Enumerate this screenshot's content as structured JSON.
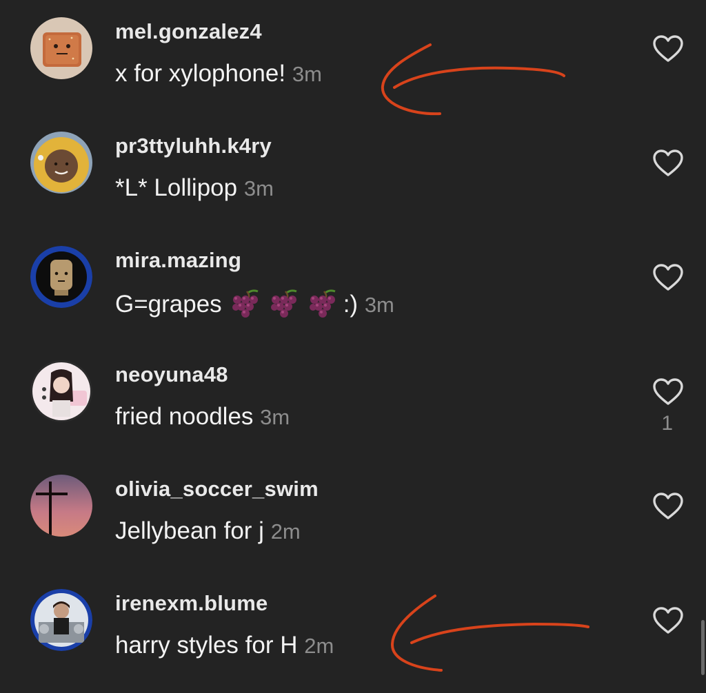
{
  "comments": [
    {
      "username": "mel.gonzalez4",
      "text": "x for xylophone!",
      "time": "3m",
      "like_count": ""
    },
    {
      "username": "pr3ttyluhh.k4ry",
      "text": "*L* Lollipop",
      "time": "3m",
      "like_count": ""
    },
    {
      "username": "mira.mazing",
      "text": "G=grapes",
      "suffix": ":)",
      "time": "3m",
      "like_count": ""
    },
    {
      "username": "neoyuna48",
      "text": "fried noodles",
      "time": "3m",
      "like_count": "1"
    },
    {
      "username": "olivia_soccer_swim",
      "text": "Jellybean for j",
      "time": "2m",
      "like_count": ""
    },
    {
      "username": "irenexm.blume",
      "text": "harry styles for H",
      "time": "2m",
      "like_count": ""
    }
  ],
  "colors": {
    "background": "#232323",
    "annotation_arrow": "#d8431b",
    "timestamp": "#8d8d8d"
  },
  "icons": {
    "like": "heart-outline-icon",
    "emoji": "grapes-icon"
  }
}
